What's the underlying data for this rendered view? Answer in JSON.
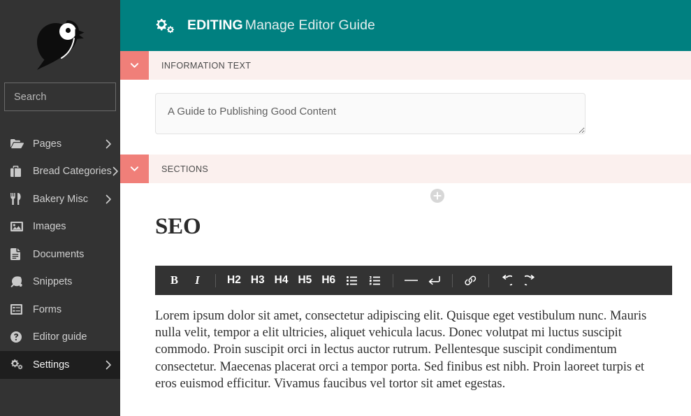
{
  "sidebar": {
    "logo_icon": "bird-logo",
    "search": {
      "placeholder": "Search",
      "value": "",
      "icon": "search-icon"
    },
    "items": [
      {
        "label": "Pages",
        "icon": "folder-open-icon",
        "has_caret": true,
        "active": false
      },
      {
        "label": "Bread Categories",
        "icon": "briefcase-icon",
        "has_caret": true,
        "active": false
      },
      {
        "label": "Bakery Misc",
        "icon": "cutlery-icon",
        "has_caret": true,
        "active": false
      },
      {
        "label": "Images",
        "icon": "image-icon",
        "has_caret": false,
        "active": false
      },
      {
        "label": "Documents",
        "icon": "file-text-icon",
        "has_caret": false,
        "active": false
      },
      {
        "label": "Snippets",
        "icon": "leaf-icon",
        "has_caret": false,
        "active": false
      },
      {
        "label": "Forms",
        "icon": "list-alt-icon",
        "has_caret": false,
        "active": false
      },
      {
        "label": "Editor guide",
        "icon": "question-circle-icon",
        "has_caret": false,
        "active": false
      },
      {
        "label": "Settings",
        "icon": "gears-icon",
        "has_caret": true,
        "active": true
      }
    ]
  },
  "header": {
    "icon": "gears-icon",
    "mode_label": "EDITING",
    "title": "Manage Editor Guide",
    "background_color": "#008080"
  },
  "panels": {
    "information_text": {
      "title": "INFORMATION TEXT",
      "toggle_icon": "chevron-down-icon",
      "toggle_color": "#f07f79",
      "bar_color": "#fbf0ee",
      "textarea_value": "A Guide to Publishing Good Content",
      "textarea_placeholder": ""
    },
    "sections": {
      "title": "SECTIONS",
      "toggle_icon": "chevron-down-icon",
      "add_icon": "plus-circle-icon",
      "heading": "SEO",
      "toolbar": [
        {
          "label": "B",
          "name": "bold-button",
          "kind": "text-serif-bold"
        },
        {
          "label": "I",
          "name": "italic-button",
          "kind": "text-serif-italic"
        },
        {
          "label": "",
          "name": "toolbar-separator",
          "kind": "separator"
        },
        {
          "label": "H2",
          "name": "heading-2-button",
          "kind": "text-sans"
        },
        {
          "label": "H3",
          "name": "heading-3-button",
          "kind": "text-sans"
        },
        {
          "label": "H4",
          "name": "heading-4-button",
          "kind": "text-sans"
        },
        {
          "label": "H5",
          "name": "heading-5-button",
          "kind": "text-sans"
        },
        {
          "label": "H6",
          "name": "heading-6-button",
          "kind": "text-sans"
        },
        {
          "label": "",
          "name": "unordered-list-button",
          "kind": "icon-ul"
        },
        {
          "label": "",
          "name": "ordered-list-button",
          "kind": "icon-ol"
        },
        {
          "label": "",
          "name": "toolbar-separator",
          "kind": "separator"
        },
        {
          "label": "",
          "name": "horizontal-rule-button",
          "kind": "icon-hr"
        },
        {
          "label": "",
          "name": "line-break-button",
          "kind": "icon-return"
        },
        {
          "label": "",
          "name": "toolbar-separator",
          "kind": "separator"
        },
        {
          "label": "",
          "name": "link-button",
          "kind": "icon-link"
        },
        {
          "label": "",
          "name": "toolbar-separator",
          "kind": "separator"
        },
        {
          "label": "",
          "name": "undo-button",
          "kind": "icon-undo"
        },
        {
          "label": "",
          "name": "redo-button",
          "kind": "icon-redo"
        }
      ],
      "body_text": "Lorem ipsum dolor sit amet, consectetur adipiscing elit. Quisque eget vestibulum nunc. Mauris nulla velit, tempor a elit ultricies, aliquet vehicula lacus. Donec volutpat mi luctus suscipit commodo. Proin suscipit orci in lectus auctor rutrum. Pellentesque suscipit condimentum consectetur. Maecenas placerat orci a tempor porta. Sed finibus est nibh. Proin laoreet turpis et eros euismod efficitur. Vivamus faucibus vel tortor sit amet egestas."
    }
  }
}
